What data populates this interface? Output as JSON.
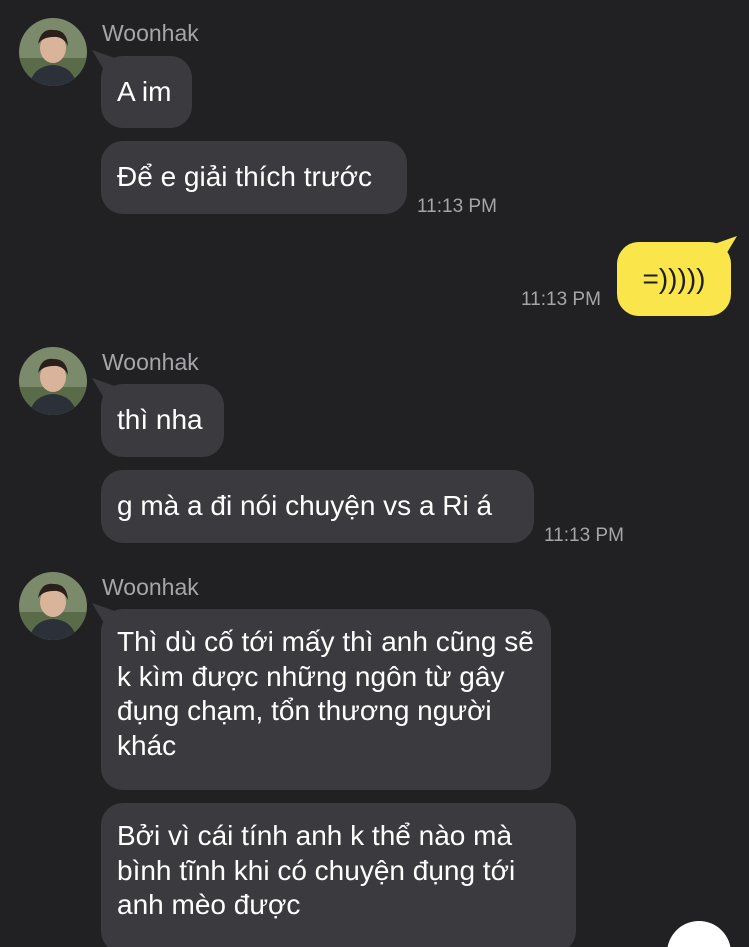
{
  "messages": {
    "group1": {
      "sender": "Woonhak",
      "bubbles": [
        "A im",
        "Để e giải thích trước"
      ],
      "time": "11:13 PM"
    },
    "mine": {
      "text": "=)))))",
      "time": "11:13 PM"
    },
    "group2": {
      "sender": "Woonhak",
      "bubbles": [
        "thì nha",
        "g mà a đi nói chuyện vs a Ri á"
      ],
      "time": "11:13 PM"
    },
    "group3": {
      "sender": "Woonhak",
      "bubbles": [
        "Thì dù cố tới mấy thì anh cũng sẽ k kìm được những ngôn từ gây đụng chạm, tổn thương người khác",
        "Bởi vì cái tính anh k thể nào mà bình tĩnh khi có chuyện đụng tới anh mèo được"
      ]
    }
  },
  "colors": {
    "background": "#212124",
    "incoming_bubble": "#3b3b3f",
    "outgoing_bubble": "#fae54b",
    "meta_text": "#a5a5aa"
  }
}
